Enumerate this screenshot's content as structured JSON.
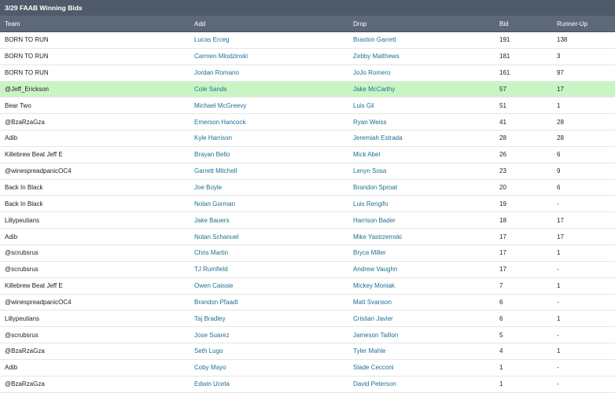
{
  "title": "3/29 FAAB Winning Bids",
  "colors": {
    "title_bg": "#4f5b6b",
    "header_bg": "#5d6878",
    "highlight_row": "#c9f5c4",
    "link": "#1f6f93"
  },
  "columns": {
    "team": "Team",
    "add": "Add",
    "drop": "Drop",
    "bid": "Bid",
    "runner_up": "Runner-Up"
  },
  "rows": [
    {
      "team": "BORN TO RUN",
      "add": "Lucas Erceg",
      "drop": "Braxton Garrett",
      "bid": "191",
      "runner_up": "138",
      "highlight": false
    },
    {
      "team": "BORN TO RUN",
      "add": "Carmen Mlodzinski",
      "drop": "Zebby Matthews",
      "bid": "181",
      "runner_up": "3",
      "highlight": false
    },
    {
      "team": "BORN TO RUN",
      "add": "Jordan Romano",
      "drop": "JoJo Romero",
      "bid": "161",
      "runner_up": "97",
      "highlight": false
    },
    {
      "team": "@Jeff_Erickson",
      "add": "Cole Sands",
      "drop": "Jake McCarthy",
      "bid": "57",
      "runner_up": "17",
      "highlight": true
    },
    {
      "team": "Bear Two",
      "add": "Michael McGreevy",
      "drop": "Luis Gil",
      "bid": "51",
      "runner_up": "1",
      "highlight": false
    },
    {
      "team": "@BzaRzaGza",
      "add": "Emerson Hancock",
      "drop": "Ryan Weiss",
      "bid": "41",
      "runner_up": "28",
      "highlight": false
    },
    {
      "team": "Adib",
      "add": "Kyle Harrison",
      "drop": "Jeremiah Estrada",
      "bid": "28",
      "runner_up": "28",
      "highlight": false
    },
    {
      "team": "Killebrew Beat Jeff E",
      "add": "Brayan Bello",
      "drop": "Mick Abel",
      "bid": "26",
      "runner_up": "6",
      "highlight": false
    },
    {
      "team": "@winespreadpanicOC4",
      "add": "Garrett Mitchell",
      "drop": "Lenyn Sosa",
      "bid": "23",
      "runner_up": "9",
      "highlight": false
    },
    {
      "team": "Back In Black",
      "add": "Joe Boyle",
      "drop": "Brandon Sproat",
      "bid": "20",
      "runner_up": "6",
      "highlight": false
    },
    {
      "team": "Back In Black",
      "add": "Nolan Gorman",
      "drop": "Luis Rengifo",
      "bid": "19",
      "runner_up": "-",
      "highlight": false
    },
    {
      "team": "Lillypeutians",
      "add": "Jake Bauers",
      "drop": "Harrison Bader",
      "bid": "18",
      "runner_up": "17",
      "highlight": false
    },
    {
      "team": "Adib",
      "add": "Nolan Schanuel",
      "drop": "Mike Yastrzemski",
      "bid": "17",
      "runner_up": "17",
      "highlight": false
    },
    {
      "team": "@scrubsrus",
      "add": "Chris Martin",
      "drop": "Bryce Miller",
      "bid": "17",
      "runner_up": "1",
      "highlight": false
    },
    {
      "team": "@scrubsrus",
      "add": "TJ Rumfield",
      "drop": "Andrew Vaughn",
      "bid": "17",
      "runner_up": "-",
      "highlight": false
    },
    {
      "team": "Killebrew Beat Jeff E",
      "add": "Owen Caissie",
      "drop": "Mickey Moniak",
      "bid": "7",
      "runner_up": "1",
      "highlight": false
    },
    {
      "team": "@winespreadpanicOC4",
      "add": "Brandon Pfaadt",
      "drop": "Matt Svanson",
      "bid": "6",
      "runner_up": "-",
      "highlight": false
    },
    {
      "team": "Lillypeutians",
      "add": "Taj Bradley",
      "drop": "Cristian Javier",
      "bid": "6",
      "runner_up": "1",
      "highlight": false
    },
    {
      "team": "@scrubsrus",
      "add": "Jose Suarez",
      "drop": "Jameson Taillon",
      "bid": "5",
      "runner_up": "-",
      "highlight": false
    },
    {
      "team": "@BzaRzaGza",
      "add": "Seth Lugo",
      "drop": "Tyler Mahle",
      "bid": "4",
      "runner_up": "1",
      "highlight": false
    },
    {
      "team": "Adib",
      "add": "Coby Mayo",
      "drop": "Slade Cecconi",
      "bid": "1",
      "runner_up": "-",
      "highlight": false
    },
    {
      "team": "@BzaRzaGza",
      "add": "Edwin Uceta",
      "drop": "David Peterson",
      "bid": "1",
      "runner_up": "-",
      "highlight": false
    }
  ]
}
